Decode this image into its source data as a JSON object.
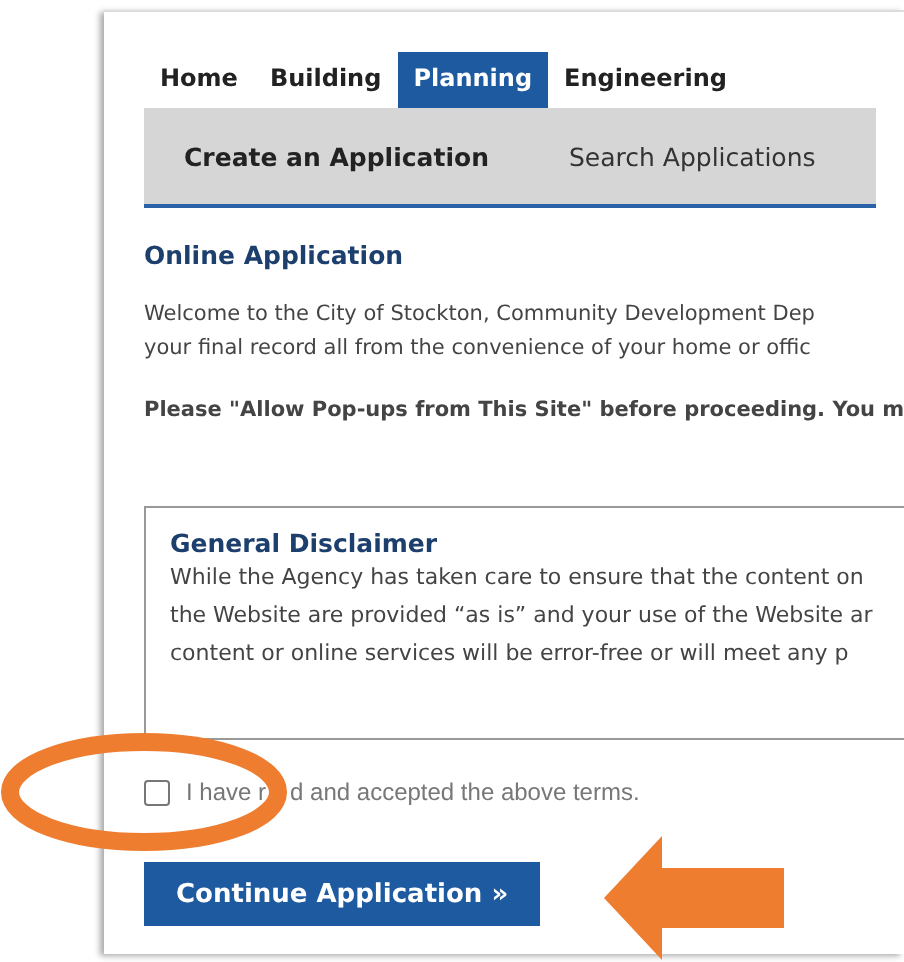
{
  "tabs": [
    {
      "label": "Home",
      "selected": false
    },
    {
      "label": "Building",
      "selected": false
    },
    {
      "label": "Planning",
      "selected": true
    },
    {
      "label": "Engineering",
      "selected": false
    }
  ],
  "subnav": [
    {
      "label": "Create an Application",
      "selected": true
    },
    {
      "label": "Search Applications",
      "selected": false
    }
  ],
  "section_title": "Online Application",
  "intro": [
    "Welcome to the City of Stockton, Community Development Dep",
    "your final record all from the convenience of your home or offic"
  ],
  "popup_notice": "Please \"Allow Pop-ups from This Site\" before proceeding. You m",
  "disclaimer": {
    "title": "General Disclaimer",
    "lines": [
      "While the Agency has taken care to ensure that the content on",
      "the Website are provided “as is” and your use of the Website ar",
      "content or online services will be error-free or will meet any p"
    ]
  },
  "agreement": {
    "checked": false,
    "label_parts": [
      "I have r",
      "d and accepted the above terms."
    ]
  },
  "continue_button": "Continue Application »"
}
